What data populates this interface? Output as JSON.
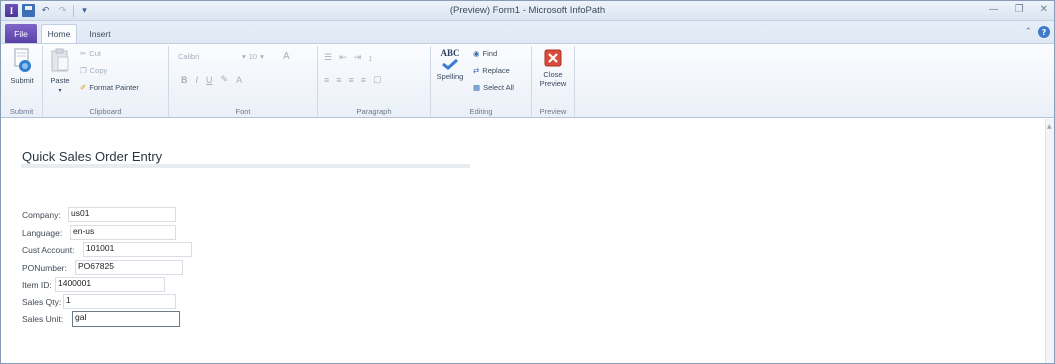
{
  "window": {
    "title": "(Preview) Form1 - Microsoft InfoPath",
    "app_icon_letter": "I",
    "controls": [
      "—",
      "❐",
      "✕"
    ]
  },
  "tabs": {
    "file": "File",
    "home": "Home",
    "insert": "Insert"
  },
  "ribbon": {
    "groups": {
      "submit": "Submit",
      "clipboard": "Clipboard",
      "font": "Font",
      "paragraph": "Paragraph",
      "editing": "Editing",
      "preview": "Preview"
    },
    "submit_button": "Submit",
    "paste_button": "Paste",
    "cut": "Cut",
    "copy": "Copy",
    "format_painter": "Format Painter",
    "font_name": "Calibri",
    "font_size": "10",
    "spelling": "Spelling",
    "spelling_abc": "ABC",
    "find": "Find",
    "replace": "Replace",
    "select_all": "Select All",
    "close_preview_1": "Close",
    "close_preview_2": "Preview"
  },
  "form": {
    "title": "Quick Sales Order Entry",
    "fields": [
      {
        "label": "Company:",
        "value": "us01"
      },
      {
        "label": "Language:",
        "value": "en-us"
      },
      {
        "label": "Cust Account:",
        "value": "101001"
      },
      {
        "label": "PONumber:",
        "value": "PO67825"
      },
      {
        "label": "Item ID:",
        "value": "1400001"
      },
      {
        "label": "Sales Qty:",
        "value": "1"
      },
      {
        "label": "Sales Unit:",
        "value": "gal"
      }
    ]
  }
}
